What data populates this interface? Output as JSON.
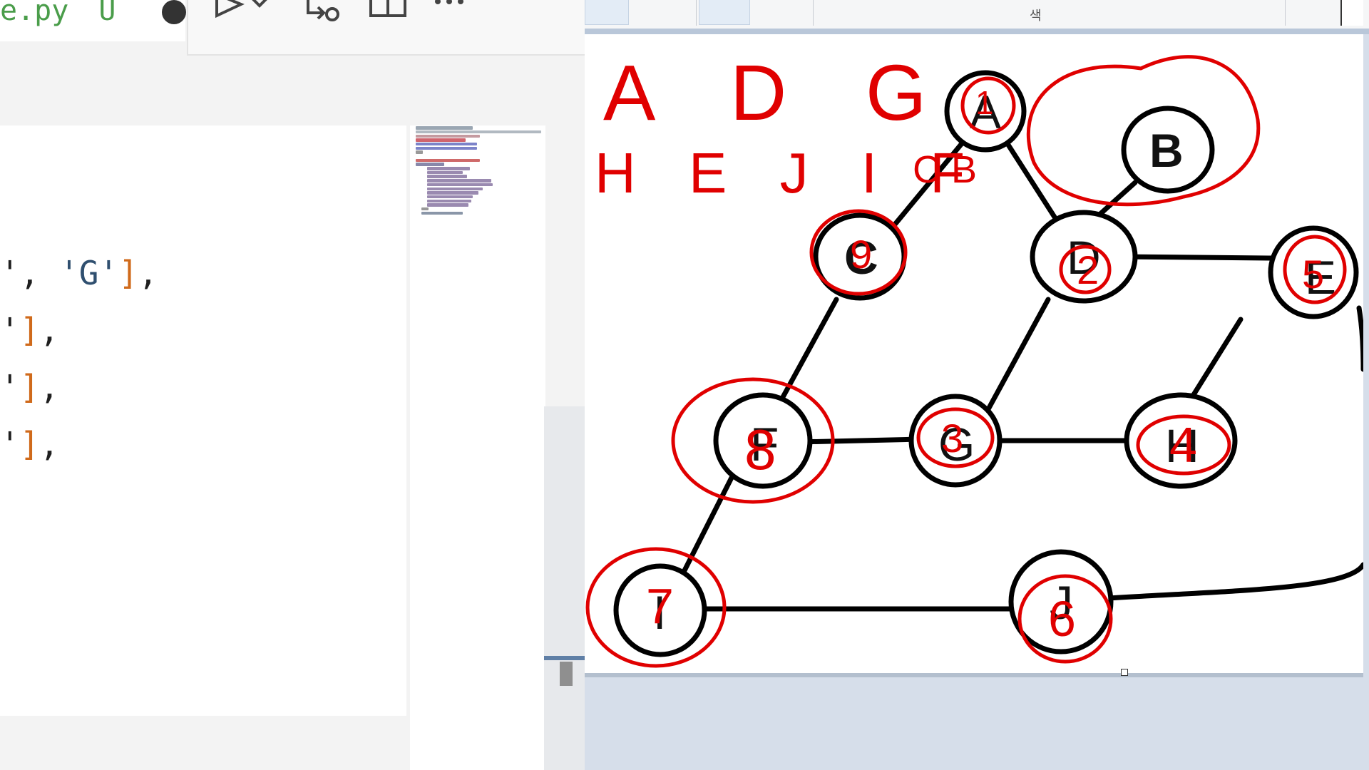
{
  "editor": {
    "tab_filename": "e.py",
    "tab_badge": "U",
    "code_lines": [
      {
        "prefix": "', ",
        "str": "'G'",
        "bracket": "]",
        "suffix": ","
      },
      {
        "prefix": "'",
        "str": "",
        "bracket": "]",
        "suffix": ","
      },
      {
        "prefix": "'",
        "str": "",
        "bracket": "]",
        "suffix": ","
      },
      {
        "prefix": "'",
        "str": "",
        "bracket": "]",
        "suffix": ","
      }
    ],
    "toolbar_icons": [
      "run-icon",
      "chevron-down-icon",
      "debug-step-icon",
      "split-editor-icon",
      "more-icon"
    ]
  },
  "paint": {
    "ribbon_label": "색",
    "graph": {
      "nodes": [
        {
          "id": "A",
          "label": "A"
        },
        {
          "id": "B",
          "label": "B"
        },
        {
          "id": "C",
          "label": "C"
        },
        {
          "id": "D",
          "label": "D"
        },
        {
          "id": "E",
          "label": "E"
        },
        {
          "id": "F",
          "label": "F"
        },
        {
          "id": "G",
          "label": "G"
        },
        {
          "id": "H",
          "label": "H"
        },
        {
          "id": "I",
          "label": "I"
        },
        {
          "id": "J",
          "label": "J"
        }
      ]
    },
    "annotations": {
      "top_line": "A D G",
      "second_line": "H E J I F",
      "stack_note": "C B",
      "order_numbers": {
        "A": "1",
        "C": "9",
        "D": "2",
        "E": "5",
        "F": "8",
        "G": "3",
        "H": "4",
        "I": "7",
        "J": "6"
      },
      "ink_color": "#e00000"
    }
  }
}
